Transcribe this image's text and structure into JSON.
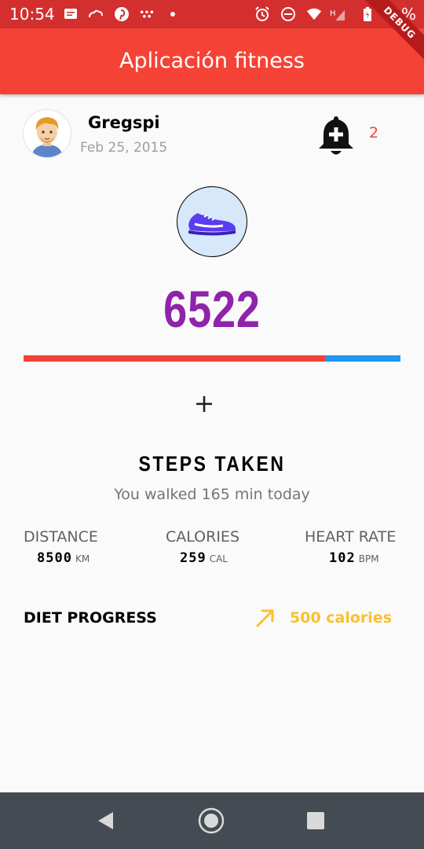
{
  "status_bar": {
    "time": "10:54",
    "battery": "71%",
    "icons": [
      "message-icon",
      "cloud-icon",
      "pinterest-icon",
      "game-icon",
      "dot-icon",
      "alarm-icon",
      "dnd-icon",
      "wifi-icon",
      "signal-icon",
      "battery-icon"
    ]
  },
  "app_bar": {
    "title": "Aplicación fitness",
    "debug_label": "DEBUG"
  },
  "profile": {
    "name": "Gregspi",
    "date": "Feb 25, 2015",
    "notification_count": "2"
  },
  "steps": {
    "count": "6522",
    "progress": 0.8,
    "title": "STEPS TAKEN",
    "subtitle": "You walked 165 min today"
  },
  "stats": [
    {
      "label": "DISTANCE",
      "value": "8500",
      "unit": "KM"
    },
    {
      "label": "CALORIES",
      "value": "259",
      "unit": "CAL"
    },
    {
      "label": "HEART RATE",
      "value": "102",
      "unit": "BPM"
    }
  ],
  "diet": {
    "label": "DIET PROGRESS",
    "value": "500 calories"
  },
  "colors": {
    "status_bar": "#d32f2f",
    "app_bar": "#f44336",
    "steps_number": "#8e24aa",
    "progress_fill": "#f44336",
    "progress_track": "#2196f3",
    "diet_accent": "#fbc02d",
    "nav_bar": "#444b52"
  }
}
